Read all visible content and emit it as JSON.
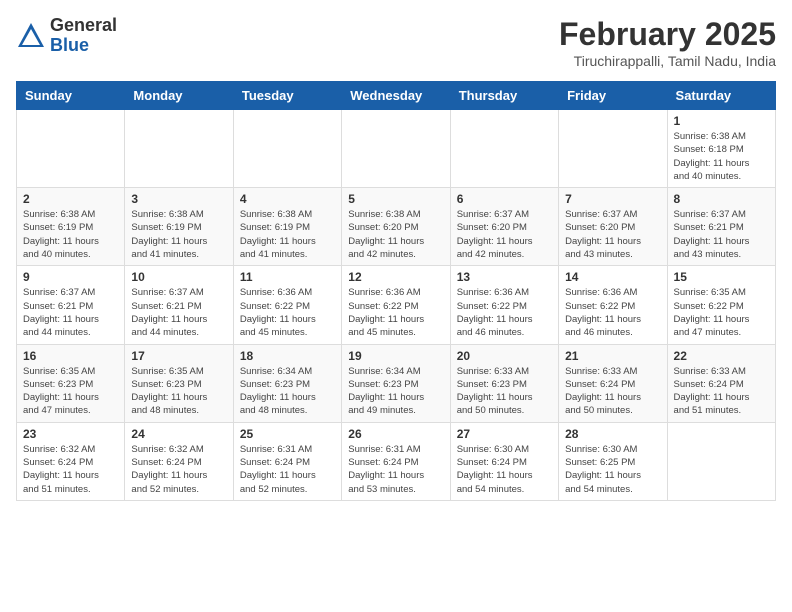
{
  "logo": {
    "general": "General",
    "blue": "Blue"
  },
  "header": {
    "month_title": "February 2025",
    "location": "Tiruchirappalli, Tamil Nadu, India"
  },
  "weekdays": [
    "Sunday",
    "Monday",
    "Tuesday",
    "Wednesday",
    "Thursday",
    "Friday",
    "Saturday"
  ],
  "weeks": [
    [
      {
        "day": "",
        "info": ""
      },
      {
        "day": "",
        "info": ""
      },
      {
        "day": "",
        "info": ""
      },
      {
        "day": "",
        "info": ""
      },
      {
        "day": "",
        "info": ""
      },
      {
        "day": "",
        "info": ""
      },
      {
        "day": "1",
        "info": "Sunrise: 6:38 AM\nSunset: 6:18 PM\nDaylight: 11 hours\nand 40 minutes."
      }
    ],
    [
      {
        "day": "2",
        "info": "Sunrise: 6:38 AM\nSunset: 6:19 PM\nDaylight: 11 hours\nand 40 minutes."
      },
      {
        "day": "3",
        "info": "Sunrise: 6:38 AM\nSunset: 6:19 PM\nDaylight: 11 hours\nand 41 minutes."
      },
      {
        "day": "4",
        "info": "Sunrise: 6:38 AM\nSunset: 6:19 PM\nDaylight: 11 hours\nand 41 minutes."
      },
      {
        "day": "5",
        "info": "Sunrise: 6:38 AM\nSunset: 6:20 PM\nDaylight: 11 hours\nand 42 minutes."
      },
      {
        "day": "6",
        "info": "Sunrise: 6:37 AM\nSunset: 6:20 PM\nDaylight: 11 hours\nand 42 minutes."
      },
      {
        "day": "7",
        "info": "Sunrise: 6:37 AM\nSunset: 6:20 PM\nDaylight: 11 hours\nand 43 minutes."
      },
      {
        "day": "8",
        "info": "Sunrise: 6:37 AM\nSunset: 6:21 PM\nDaylight: 11 hours\nand 43 minutes."
      }
    ],
    [
      {
        "day": "9",
        "info": "Sunrise: 6:37 AM\nSunset: 6:21 PM\nDaylight: 11 hours\nand 44 minutes."
      },
      {
        "day": "10",
        "info": "Sunrise: 6:37 AM\nSunset: 6:21 PM\nDaylight: 11 hours\nand 44 minutes."
      },
      {
        "day": "11",
        "info": "Sunrise: 6:36 AM\nSunset: 6:22 PM\nDaylight: 11 hours\nand 45 minutes."
      },
      {
        "day": "12",
        "info": "Sunrise: 6:36 AM\nSunset: 6:22 PM\nDaylight: 11 hours\nand 45 minutes."
      },
      {
        "day": "13",
        "info": "Sunrise: 6:36 AM\nSunset: 6:22 PM\nDaylight: 11 hours\nand 46 minutes."
      },
      {
        "day": "14",
        "info": "Sunrise: 6:36 AM\nSunset: 6:22 PM\nDaylight: 11 hours\nand 46 minutes."
      },
      {
        "day": "15",
        "info": "Sunrise: 6:35 AM\nSunset: 6:22 PM\nDaylight: 11 hours\nand 47 minutes."
      }
    ],
    [
      {
        "day": "16",
        "info": "Sunrise: 6:35 AM\nSunset: 6:23 PM\nDaylight: 11 hours\nand 47 minutes."
      },
      {
        "day": "17",
        "info": "Sunrise: 6:35 AM\nSunset: 6:23 PM\nDaylight: 11 hours\nand 48 minutes."
      },
      {
        "day": "18",
        "info": "Sunrise: 6:34 AM\nSunset: 6:23 PM\nDaylight: 11 hours\nand 48 minutes."
      },
      {
        "day": "19",
        "info": "Sunrise: 6:34 AM\nSunset: 6:23 PM\nDaylight: 11 hours\nand 49 minutes."
      },
      {
        "day": "20",
        "info": "Sunrise: 6:33 AM\nSunset: 6:23 PM\nDaylight: 11 hours\nand 50 minutes."
      },
      {
        "day": "21",
        "info": "Sunrise: 6:33 AM\nSunset: 6:24 PM\nDaylight: 11 hours\nand 50 minutes."
      },
      {
        "day": "22",
        "info": "Sunrise: 6:33 AM\nSunset: 6:24 PM\nDaylight: 11 hours\nand 51 minutes."
      }
    ],
    [
      {
        "day": "23",
        "info": "Sunrise: 6:32 AM\nSunset: 6:24 PM\nDaylight: 11 hours\nand 51 minutes."
      },
      {
        "day": "24",
        "info": "Sunrise: 6:32 AM\nSunset: 6:24 PM\nDaylight: 11 hours\nand 52 minutes."
      },
      {
        "day": "25",
        "info": "Sunrise: 6:31 AM\nSunset: 6:24 PM\nDaylight: 11 hours\nand 52 minutes."
      },
      {
        "day": "26",
        "info": "Sunrise: 6:31 AM\nSunset: 6:24 PM\nDaylight: 11 hours\nand 53 minutes."
      },
      {
        "day": "27",
        "info": "Sunrise: 6:30 AM\nSunset: 6:24 PM\nDaylight: 11 hours\nand 54 minutes."
      },
      {
        "day": "28",
        "info": "Sunrise: 6:30 AM\nSunset: 6:25 PM\nDaylight: 11 hours\nand 54 minutes."
      },
      {
        "day": "",
        "info": ""
      }
    ]
  ]
}
